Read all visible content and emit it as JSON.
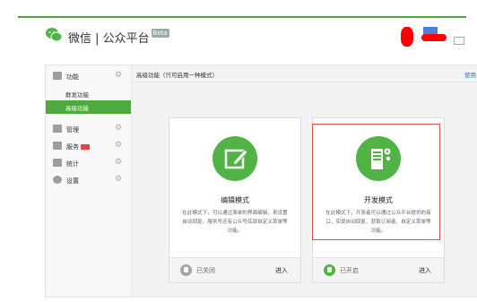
{
  "header": {
    "title": "微信 | 公众平台",
    "beta_badge": "Beta"
  },
  "sidebar": {
    "items": [
      {
        "label": "功能",
        "icon": "grid-icon"
      },
      {
        "label": "管理",
        "icon": "folder-icon"
      },
      {
        "label": "服务",
        "icon": "service-icon"
      },
      {
        "label": "统计",
        "icon": "chart-icon"
      },
      {
        "label": "设置",
        "icon": "gear-icon"
      }
    ],
    "subitems": [
      {
        "label": "群发功能"
      },
      {
        "label": "高级功能",
        "active": true
      }
    ]
  },
  "content": {
    "breadcrumb": "高级功能（只可启用一种模式）",
    "help_link": "使用"
  },
  "cards": [
    {
      "name": "编辑模式",
      "desc": "在此模式下，可以通过简单的界面编辑，来设置自动回复。服务号还有公众号底部自定义菜单等功能。",
      "status": "已关闭",
      "enter": "进入",
      "icon": "edit-icon"
    },
    {
      "name": "开发模式",
      "desc": "在此模式下，开发者可以通过公众平台提供的接口，实现自动回复、获取订阅者、自定义菜单等功能。",
      "status": "已开启",
      "enter": "进入",
      "icon": "server-icon"
    }
  ],
  "colors": {
    "accent_green": "#4eaa3c",
    "highlight_red": "#e05050",
    "redaction_red": "#ff0000"
  }
}
